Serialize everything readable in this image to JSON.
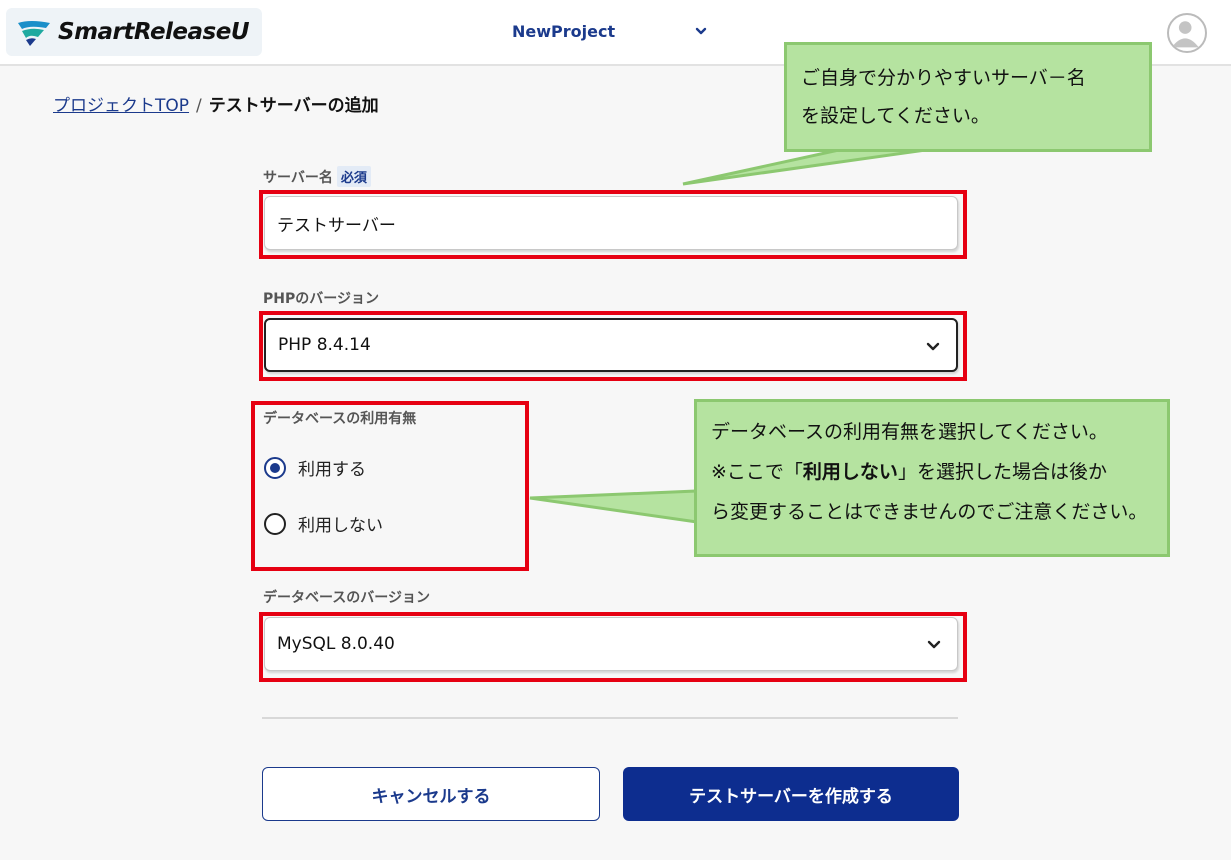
{
  "header": {
    "logo_text": "SmartReleaseU",
    "project_name": "NewProject"
  },
  "breadcrumb": {
    "link": "プロジェクトTOP",
    "separator": "/",
    "current": "テストサーバーの追加"
  },
  "form": {
    "server_name_label": "サーバー名",
    "required_badge": "必須",
    "server_name_value": "テストサーバー",
    "php_label": "PHPのバージョン",
    "php_value": "PHP 8.4.14",
    "db_use_label": "データベースの利用有無",
    "db_use_options": [
      {
        "label": "利用する",
        "selected": true
      },
      {
        "label": "利用しない",
        "selected": false
      }
    ],
    "db_version_label": "データベースのバージョン",
    "db_version_value": "MySQL 8.0.40",
    "cancel_label": "キャンセルする",
    "create_label": "テストサーバーを作成する"
  },
  "callouts": {
    "server_name_line1": "ご自身で分かりやすいサーバ－名",
    "server_name_line2": "を設定してください。",
    "db_line1": "データベースの利用有無を選択してください。",
    "db_line2_pre": "※ここで「",
    "db_line2_bold": "利用しない",
    "db_line2_post": "」を選択した場合は後か",
    "db_line3": "ら変更することはできませんのでご注意ください。"
  },
  "colors": {
    "brand": "#0d2d8f",
    "link": "#1b3a8c",
    "highlight": "#e60012",
    "callout_fill": "#b5e3a0",
    "callout_border": "#8cc870"
  }
}
